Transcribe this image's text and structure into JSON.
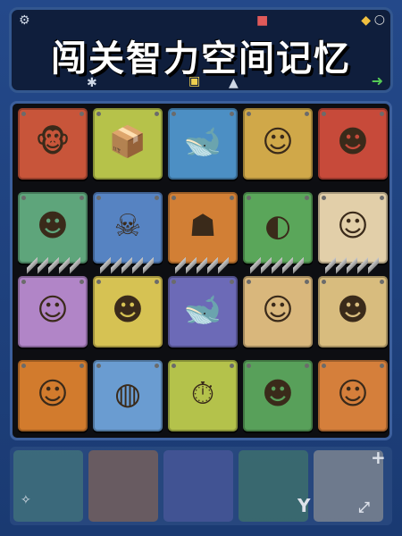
{
  "header": {
    "title": "闯关智力空间记忆"
  },
  "icons": {
    "settings": "gear-icon",
    "coin": "coin-icon",
    "next": "arrow-right-icon",
    "info": "snowflake-icon",
    "lock": "lock-icon",
    "up": "chevron-up-icon"
  },
  "tiles": [
    {
      "face": "monkey",
      "bg": "#c8553a"
    },
    {
      "face": "box",
      "bg": "#b6c24a"
    },
    {
      "face": "orca",
      "bg": "#4c8fc4"
    },
    {
      "face": "boy",
      "bg": "#d0a849"
    },
    {
      "face": "bald",
      "bg": "#c74a3a"
    },
    {
      "face": "frank",
      "bg": "#5ea57b"
    },
    {
      "face": "skull",
      "bg": "#5683c2"
    },
    {
      "face": "monster",
      "bg": "#d27f35"
    },
    {
      "face": "bird",
      "bg": "#5aa65a"
    },
    {
      "face": "boy2",
      "bg": "#e2cfa9"
    },
    {
      "face": "baby",
      "bg": "#b185c7"
    },
    {
      "face": "man",
      "bg": "#d6c253"
    },
    {
      "face": "orca2",
      "bg": "#6c6ab7"
    },
    {
      "face": "boy3",
      "bg": "#d9b77c"
    },
    {
      "face": "man2",
      "bg": "#d8bc7e"
    },
    {
      "face": "blonde",
      "bg": "#d27b2d"
    },
    {
      "face": "ball",
      "bg": "#6a9cd1"
    },
    {
      "face": "stopwatch",
      "bg": "#b4c24b"
    },
    {
      "face": "bowl",
      "bg": "#58a05a"
    },
    {
      "face": "curly",
      "bg": "#d57f3b"
    }
  ]
}
